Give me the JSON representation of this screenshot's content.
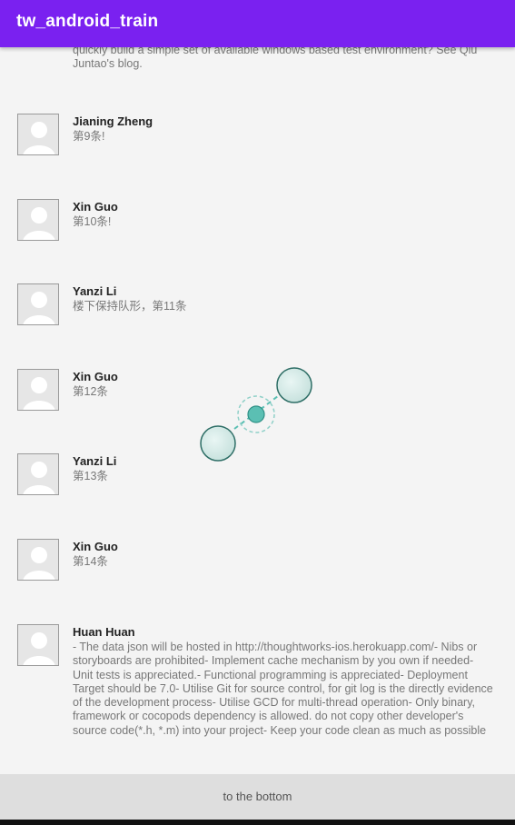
{
  "app": {
    "title": "tw_android_train"
  },
  "feed": {
    "partial_text": "quickly build a simple set of available windows based test environment? See Qiu Juntao's blog.",
    "items": [
      {
        "name": "Jianing Zheng",
        "text": "第9条!"
      },
      {
        "name": "Xin Guo",
        "text": "第10条!"
      },
      {
        "name": "Yanzi Li",
        "text": "楼下保持队形，第11条"
      },
      {
        "name": "Xin Guo",
        "text": "第12条"
      },
      {
        "name": "Yanzi Li",
        "text": "第13条"
      },
      {
        "name": "Xin Guo",
        "text": "第14条"
      },
      {
        "name": "Huan Huan",
        "text": "- The data json will be hosted in http://thoughtworks-ios.herokuapp.com/- Nibs or storyboards are prohibited- Implement cache mechanism by you own if needed- Unit tests is appreciated.- Functional programming is appreciated- Deployment Target should be 7.0- Utilise Git for source control, for git log is the directly evidence of the development process- Utilise GCD for multi-thread operation- Only binary, framework or cocopods dependency is allowed. do not copy other developer's source code(*.h, *.m) into your project- Keep your code clean as much as possible"
      }
    ]
  },
  "footer": {
    "button_label": "to the bottom"
  },
  "colors": {
    "appbar": "#7a21f0",
    "background": "#f4f4f4",
    "button": "#dedede"
  },
  "icons": {
    "avatar": "person-placeholder-icon"
  }
}
